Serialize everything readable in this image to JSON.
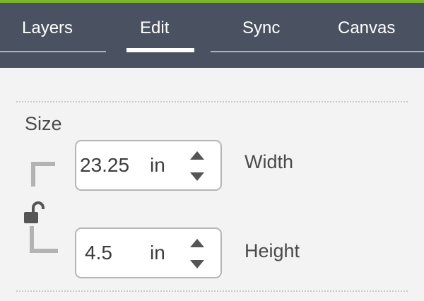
{
  "colors": {
    "accent": "#7ab52a",
    "tabbar_bg": "#4a5262",
    "panel_bg": "#f3f3f3",
    "text": "#4a4a4a"
  },
  "tabs": [
    {
      "label": "Layers",
      "active": false
    },
    {
      "label": "Edit",
      "active": true
    },
    {
      "label": "Sync",
      "active": false
    },
    {
      "label": "Canvas",
      "active": false
    }
  ],
  "size": {
    "title": "Size",
    "width": {
      "value": "23.25",
      "unit": "in",
      "label": "Width"
    },
    "height": {
      "value": "4.5",
      "unit": "in",
      "label": "Height"
    },
    "lock_icon": "unlocked-padlock-icon",
    "up_icon": "caret-up-icon",
    "down_icon": "caret-down-icon"
  }
}
